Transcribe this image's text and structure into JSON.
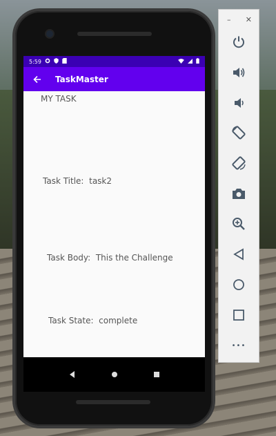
{
  "status_bar": {
    "time": "5:59"
  },
  "app_bar": {
    "title": "TaskMaster"
  },
  "detail": {
    "heading": "MY TASK",
    "title_label": "Task Title:",
    "title_value": "task2",
    "body_label": "Task Body:",
    "body_value": "This the Challenge",
    "state_label": "Task State:",
    "state_value": "complete"
  },
  "emulator_panel": {
    "minimize_symbol": "–",
    "close_symbol": "✕",
    "more_symbol": "•••",
    "tools": [
      "power-icon",
      "volume-up-icon",
      "volume-down-icon",
      "rotate-left-icon",
      "rotate-right-icon",
      "camera-icon",
      "zoom-icon",
      "back-icon",
      "home-icon",
      "overview-icon",
      "more-icon"
    ]
  },
  "colors": {
    "accent": "#6200ee",
    "status_bar": "#3b00b3",
    "content_bg": "#fafafa",
    "text": "#555555",
    "panel_icon": "#4a5a6a"
  }
}
